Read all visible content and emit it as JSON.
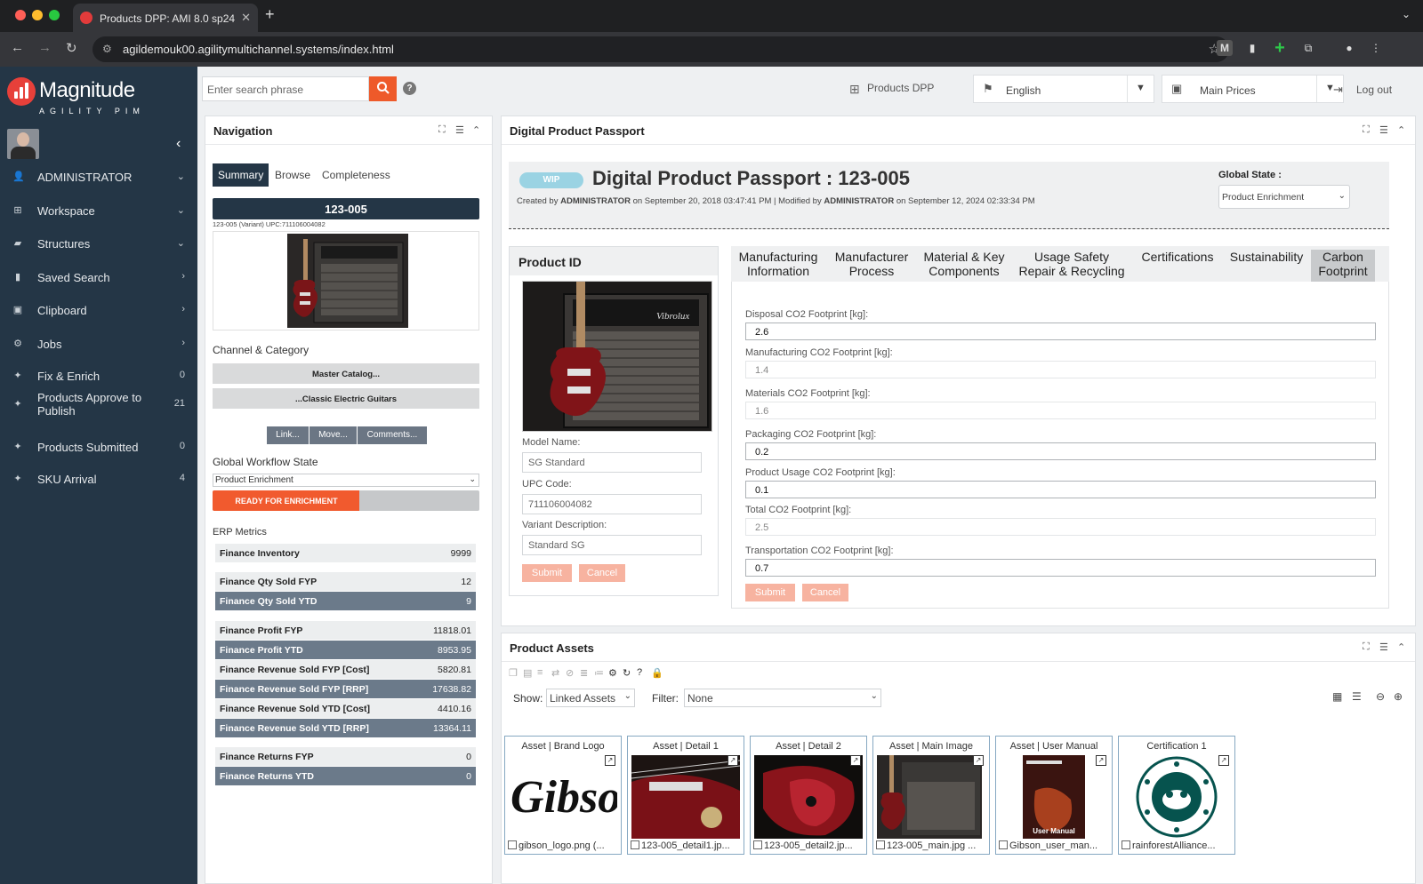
{
  "browser": {
    "tab_title": "Products DPP: AMI 8.0 sp24",
    "url": "agildemouk00.agilitymultichannel.systems/index.html"
  },
  "brand": {
    "name": "Magnitude",
    "sub": "AGILITY PIM",
    "accent": "#e7403a"
  },
  "sidebar": {
    "items": [
      {
        "label": "ADMINISTRATOR",
        "icon": "user-icon",
        "right": "⌄"
      },
      {
        "label": "Workspace",
        "icon": "grid-icon",
        "right": "⌄"
      },
      {
        "label": "Structures",
        "icon": "folder-icon",
        "right": "⌄"
      },
      {
        "label": "Saved Search",
        "icon": "bookmark-icon",
        "right": "›"
      },
      {
        "label": "Clipboard",
        "icon": "clipboard-icon",
        "right": "›"
      },
      {
        "label": "Jobs",
        "icon": "cogs-icon",
        "right": "›"
      },
      {
        "label": "Fix & Enrich",
        "icon": "pin-icon",
        "right": "0"
      },
      {
        "label": "Products Approve to Publish",
        "icon": "pin-icon",
        "right": "21"
      },
      {
        "label": "Products Submitted",
        "icon": "pin-icon",
        "right": "0"
      },
      {
        "label": "SKU Arrival",
        "icon": "pin-icon",
        "right": "4"
      }
    ]
  },
  "toolbar": {
    "search_placeholder": "Enter search phrase",
    "context": "Products DPP",
    "language": "English",
    "price_list": "Main Prices",
    "logout": "Log out"
  },
  "navigation": {
    "title": "Navigation",
    "tabs": [
      "Summary",
      "Browse",
      "Completeness"
    ],
    "sku": "123-005",
    "sku_sub": "123-005 (Variant)  UPC:711106004082",
    "channel_title": "Channel & Category",
    "channel_paths": [
      "Master Catalog...",
      "...Classic Electric Guitars"
    ],
    "buttons": [
      "Link...",
      "Move...",
      "Comments..."
    ],
    "workflow_title": "Global Workflow State",
    "workflow_value": "Product Enrichment",
    "workflow_badge": "READY FOR ENRICHMENT",
    "workflow_progress": 0.55,
    "erp_title": "ERP Metrics",
    "erp": [
      {
        "label": "Finance Inventory",
        "value": "9999",
        "style": "l"
      },
      {
        "label": "Finance Qty Sold FYP",
        "value": "12",
        "style": "l"
      },
      {
        "label": "Finance Qty Sold YTD",
        "value": "9",
        "style": "d"
      },
      {
        "label": "Finance Profit FYP",
        "value": "11818.01",
        "style": "l"
      },
      {
        "label": "Finance Profit YTD",
        "value": "8953.95",
        "style": "d"
      },
      {
        "label": "Finance Revenue Sold FYP [Cost]",
        "value": "5820.81",
        "style": "l"
      },
      {
        "label": "Finance Revenue Sold FYP [RRP]",
        "value": "17638.82",
        "style": "d"
      },
      {
        "label": "Finance Revenue Sold YTD [Cost]",
        "value": "4410.16",
        "style": "l"
      },
      {
        "label": "Finance Revenue Sold YTD [RRP]",
        "value": "13364.11",
        "style": "d"
      },
      {
        "label": "Finance Returns FYP",
        "value": "0",
        "style": "l"
      },
      {
        "label": "Finance Returns YTD",
        "value": "0",
        "style": "d"
      }
    ]
  },
  "dpp": {
    "panel_title": "Digital Product Passport",
    "status_badge": "WIP",
    "title": "Digital Product Passport : 123-005",
    "meta_created_prefix": "Created by",
    "meta_user": "ADMINISTRATOR",
    "meta_created_on": "on September 20, 2018 03:47:41 PM",
    "meta_sep": "| Modified by",
    "meta_modified_on": "on September 12, 2024 02:33:34 PM",
    "global_state_label": "Global State :",
    "global_state_value": "Product Enrichment",
    "product_id_title": "Product ID",
    "fields": [
      {
        "label": "Model Name:",
        "value": "SG Standard"
      },
      {
        "label": "UPC Code:",
        "value": "711106004082"
      },
      {
        "label": "Variant Description:",
        "value": "Standard SG"
      }
    ],
    "submit": "Submit",
    "cancel": "Cancel",
    "tabs": [
      {
        "l1": "Manufacturing",
        "l2": "Information"
      },
      {
        "l1": "Manufacturer",
        "l2": "Process"
      },
      {
        "l1": "Material & Key",
        "l2": "Components"
      },
      {
        "l1": "Usage Safety",
        "l2": "Repair & Recycling"
      },
      {
        "l1": "Certifications",
        "l2": ""
      },
      {
        "l1": "Sustainability",
        "l2": ""
      },
      {
        "l1": "Carbon",
        "l2": "Footprint"
      }
    ],
    "carbon": [
      {
        "label": "Disposal CO2 Footprint [kg]:",
        "value": "2.6",
        "editable": true
      },
      {
        "label": "Manufacturing CO2 Footprint [kg]:",
        "value": "1.4",
        "editable": false
      },
      {
        "label": "Materials CO2 Footprint [kg]:",
        "value": "1.6",
        "editable": false
      },
      {
        "label": "Packaging CO2 Footprint [kg]:",
        "value": "0.2",
        "editable": true
      },
      {
        "label": "Product Usage CO2 Footprint [kg]:",
        "value": "0.1",
        "editable": true
      },
      {
        "label": "Total CO2 Footprint [kg]:",
        "value": "2.5",
        "editable": false
      },
      {
        "label": "Transportation CO2 Footprint [kg]:",
        "value": "0.7",
        "editable": true
      }
    ]
  },
  "assets": {
    "panel_title": "Product Assets",
    "show_label": "Show:",
    "show_value": "Linked Assets",
    "filter_label": "Filter:",
    "filter_value": "None",
    "items": [
      {
        "title": "Asset | Brand Logo",
        "file": "gibson_logo.png (...",
        "kind": "logo"
      },
      {
        "title": "Asset | Detail 1",
        "file": "123-005_detail1.jp...",
        "kind": "detail1"
      },
      {
        "title": "Asset | Detail 2",
        "file": "123-005_detail2.jp...",
        "kind": "detail2"
      },
      {
        "title": "Asset | Main Image",
        "file": "123-005_main.jpg ...",
        "kind": "main"
      },
      {
        "title": "Asset | User Manual",
        "file": "Gibson_user_man...",
        "kind": "manual",
        "image_text": "User Manual"
      },
      {
        "title": "Certification 1",
        "file": "rainforestAlliance...",
        "kind": "cert"
      }
    ]
  }
}
